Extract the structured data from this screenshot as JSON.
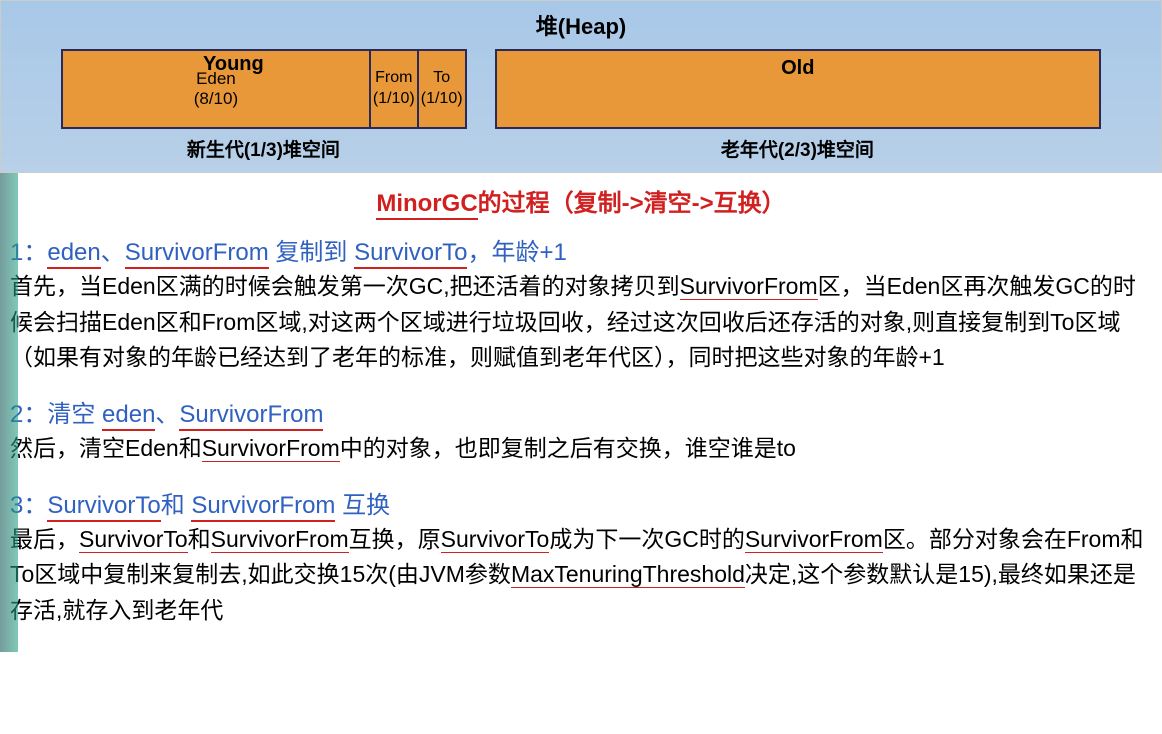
{
  "heap": {
    "title": "堆(Heap)",
    "young": {
      "label": "Young",
      "eden_name": "Eden",
      "eden_ratio": "(8/10)",
      "from_name": "From",
      "from_ratio": "(1/10)",
      "to_name": "To",
      "to_ratio": "(1/10)"
    },
    "old": {
      "label": "Old"
    },
    "caption_left": "新生代(1/3)堆空间",
    "caption_right": "老年代(2/3)堆空间"
  },
  "main_title": {
    "t1": "MinorGC",
    "t2": "的过程（复制->清空->互换）"
  },
  "step1": {
    "num": "1：",
    "w1": "eden",
    "sep": "、",
    "w2": "SurvivorFrom",
    "mid": " 复制到 ",
    "w3": "SurvivorTo",
    "tail": "，年龄+1",
    "body_a": "首先，当Eden区满的时候会触发第一次GC,把还活着的对象拷贝到",
    "body_b": "SurvivorFrom",
    "body_c": "区，当Eden区再次触发GC的时候会扫描Eden区和From区域,对这两个区域进行垃圾回收，经过这次回收后还存活的对象,则直接复制到To区域（如果有对象的年龄已经达到了老年的标准，则赋值到老年代区），同时把这些对象的年龄+1"
  },
  "step2": {
    "num": "2：",
    "head_a": "清空 ",
    "w1": "eden",
    "sep": "、",
    "w2": "SurvivorFrom",
    "body_a": "然后，清空Eden和",
    "body_b": "SurvivorFrom",
    "body_c": "中的对象，也即复制之后有交换，谁空谁是to"
  },
  "step3": {
    "num": "3：",
    "w1": "SurvivorTo",
    "mid": "和 ",
    "w2": "SurvivorFrom",
    "tail": " 互换",
    "body_a": "最后，",
    "body_b": "SurvivorTo",
    "body_c": "和",
    "body_d": "SurvivorFrom",
    "body_e": "互换，原",
    "body_f": "SurvivorTo",
    "body_g": "成为下一次GC时的",
    "body_h": "SurvivorFrom",
    "body_i": "区。部分对象会在From和To区域中复制来复制去,如此交换15次(由JVM参数",
    "body_j": "MaxTenuringThreshold",
    "body_k": "决定,这个参数默认是15),最终如果还是存活,就存入到老年代"
  }
}
